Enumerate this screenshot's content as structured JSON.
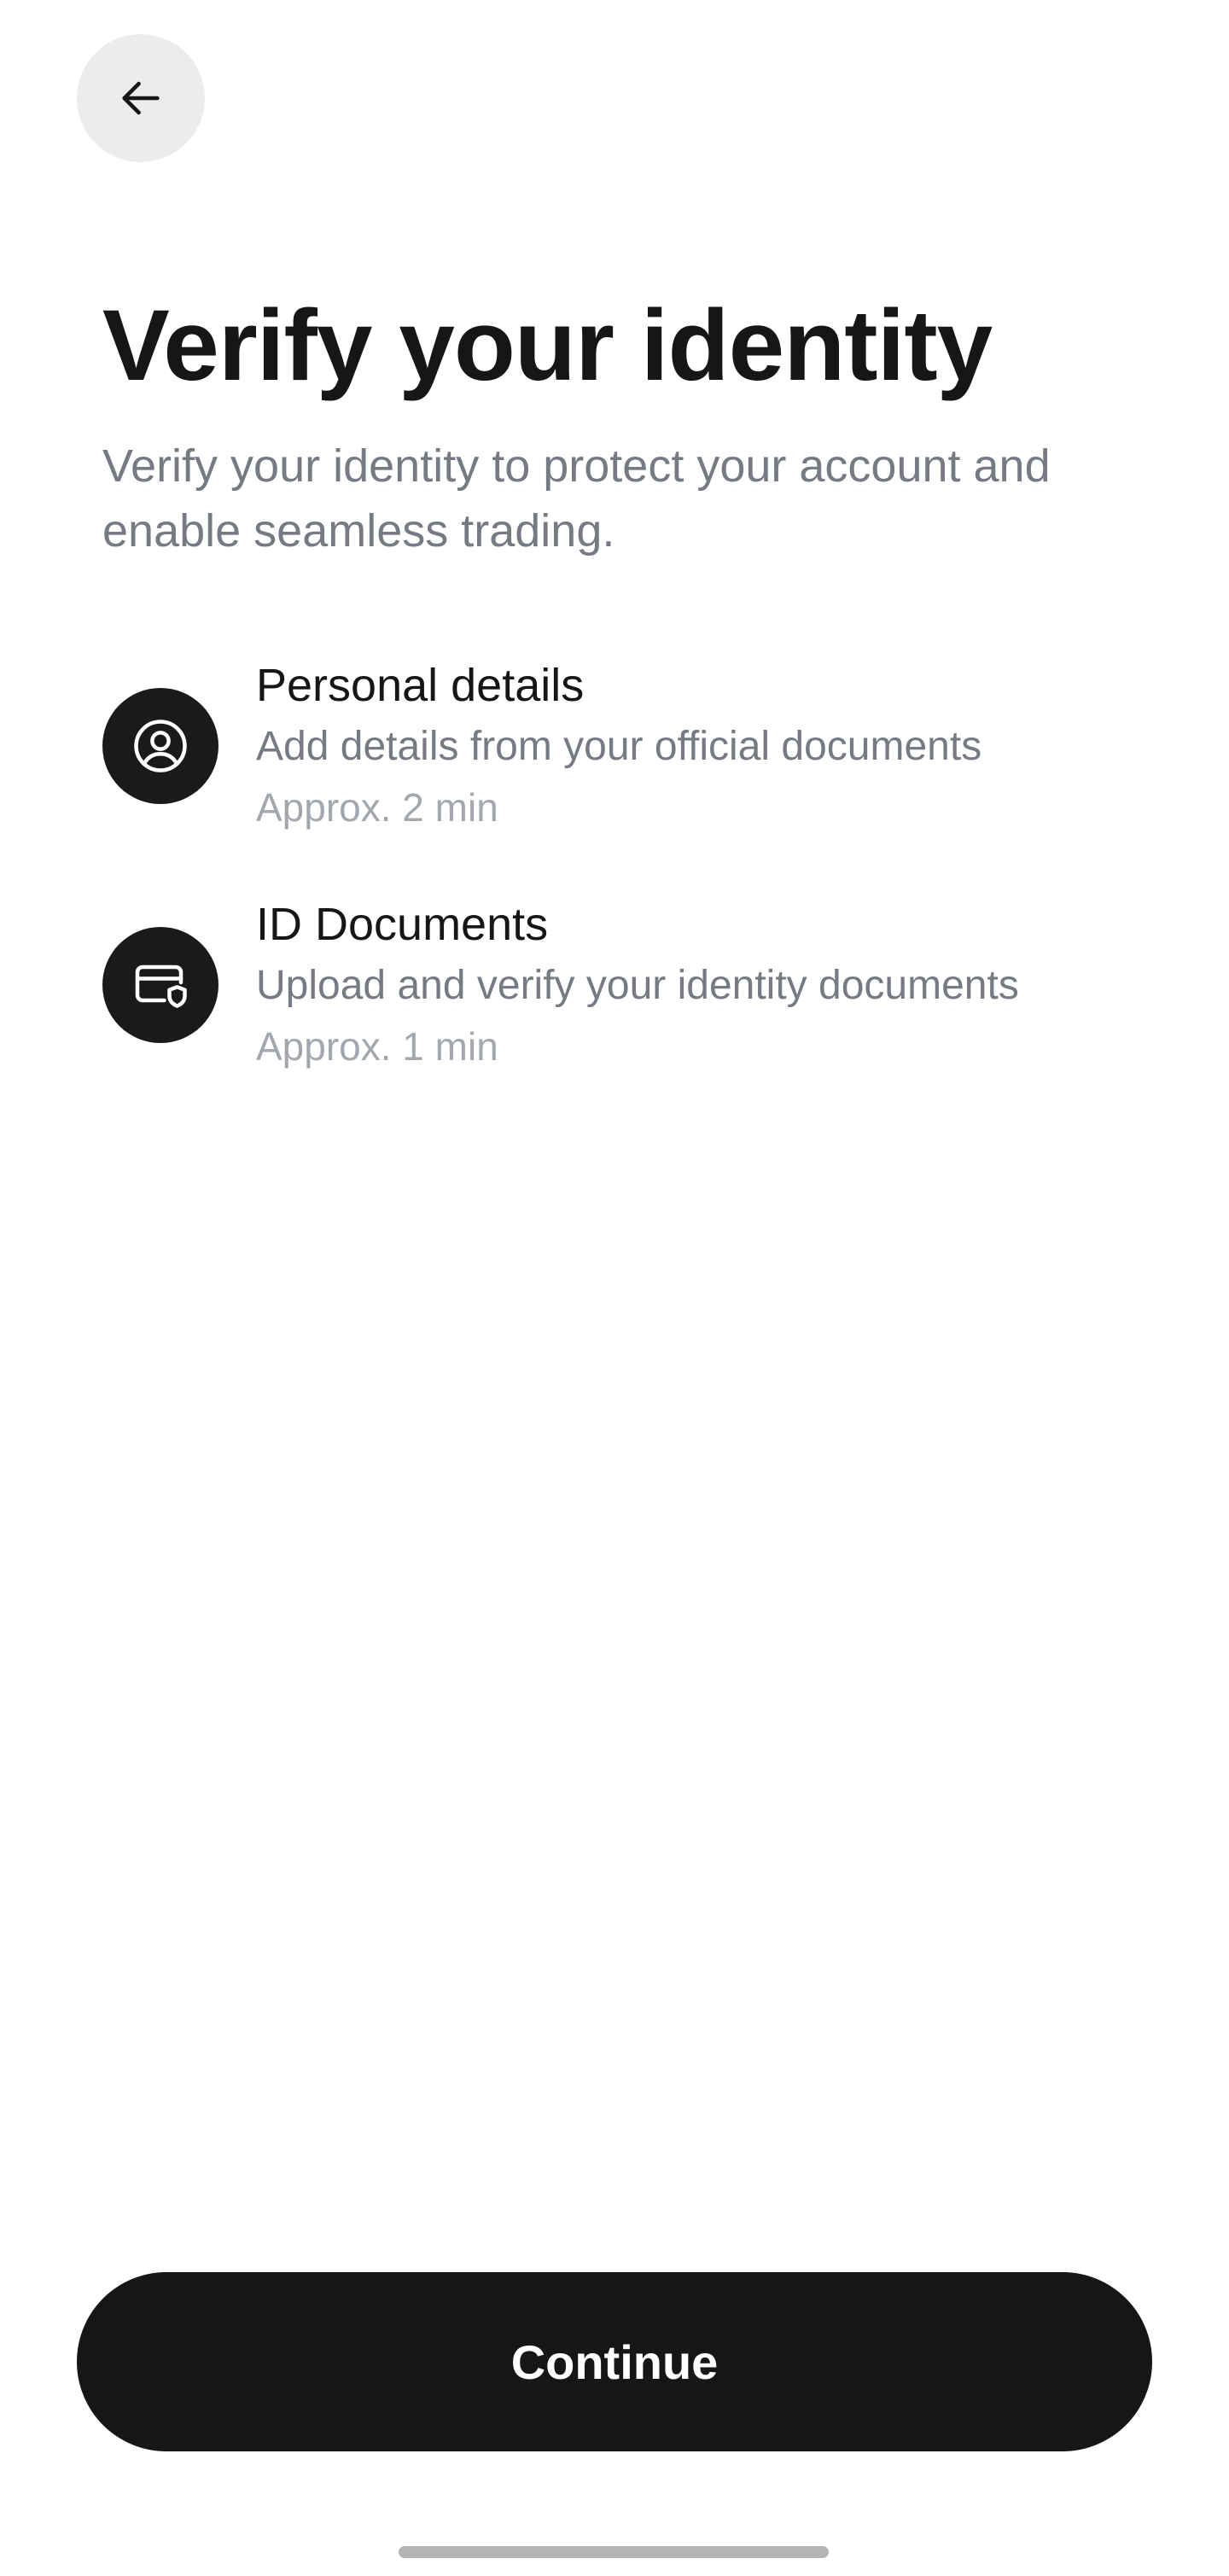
{
  "header": {
    "back_icon": "arrow-left-icon"
  },
  "page": {
    "title": "Verify your identity",
    "subtitle": "Verify your identity to protect your account and enable seamless trading."
  },
  "steps": [
    {
      "icon": "user-circle-icon",
      "title": "Personal details",
      "description": "Add details from your official documents",
      "time": "Approx. 2 min"
    },
    {
      "icon": "card-shield-icon",
      "title": "ID Documents",
      "description": "Upload and verify your identity documents",
      "time": "Approx. 1 min"
    }
  ],
  "footer": {
    "continue_label": "Continue"
  },
  "colors": {
    "primary": "#161616",
    "secondary_text": "#767A83",
    "tertiary_text": "#A3A8AF",
    "back_button_bg": "#ECECEF"
  }
}
